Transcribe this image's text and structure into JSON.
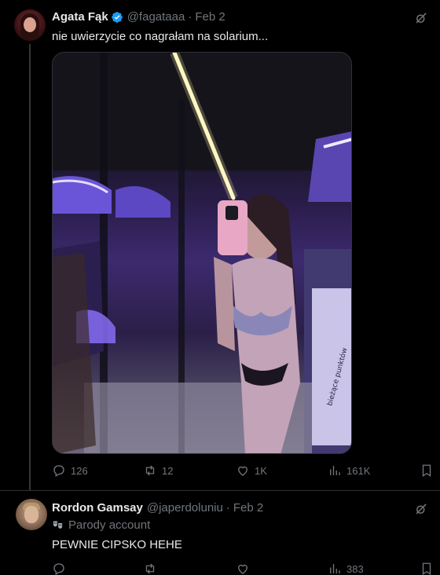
{
  "tweet1": {
    "name": "Agata Fąk",
    "handle": "@fagataaa",
    "dot": "·",
    "date": "Feb 2",
    "text": "nie uwierzycie co nagrałam na solarium...",
    "media_caption_text": "bieżące punktów",
    "stats": {
      "replies": "126",
      "reposts": "12",
      "likes": "1K",
      "views": "161K"
    }
  },
  "tweet2": {
    "name": "Rordon Gamsay",
    "handle": "@japerdoluniu",
    "dot": "·",
    "date": "Feb 2",
    "parody": "Parody account",
    "text": "PEWNIE CIPSKO HEHE",
    "stats": {
      "replies": "",
      "reposts": "",
      "likes": "",
      "views": "383"
    }
  },
  "colors": {
    "background": "#000000",
    "text": "#e7e9ea",
    "muted": "#71767b",
    "verified": "#1d9bf0",
    "divider": "#2f3336"
  },
  "icons": [
    "verified-badge-icon",
    "grok-icon",
    "reply-icon",
    "repost-icon",
    "like-icon",
    "views-icon",
    "bookmark-icon",
    "parody-mask-icon"
  ]
}
